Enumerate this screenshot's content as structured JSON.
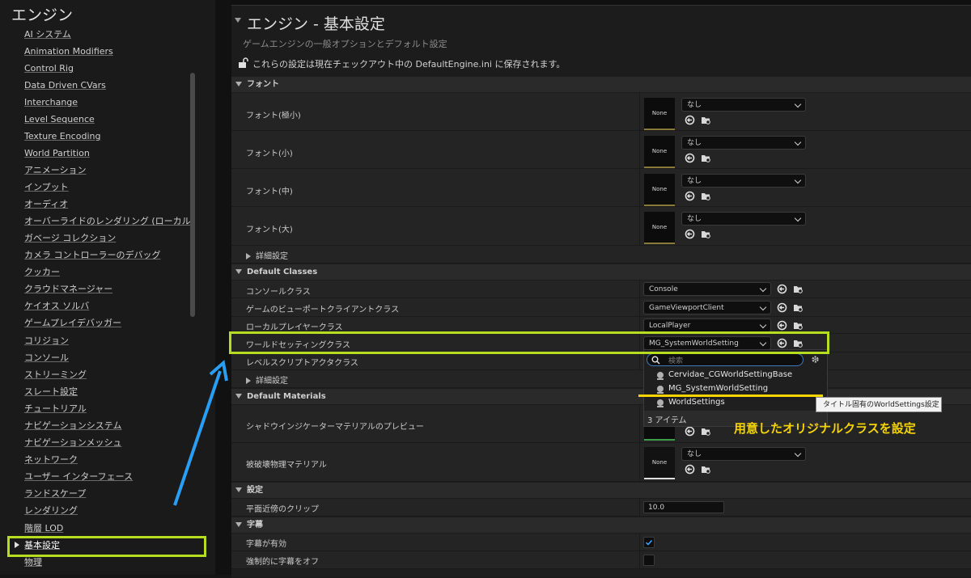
{
  "sidebar": {
    "title": "エンジン",
    "items": [
      {
        "label": "AI システム"
      },
      {
        "label": "Animation Modifiers"
      },
      {
        "label": "Control Rig"
      },
      {
        "label": "Data Driven CVars"
      },
      {
        "label": "Interchange"
      },
      {
        "label": "Level Sequence"
      },
      {
        "label": "Texture Encoding"
      },
      {
        "label": "World Partition"
      },
      {
        "label": "アニメーション"
      },
      {
        "label": "インプット"
      },
      {
        "label": "オーディオ"
      },
      {
        "label": "オーバーライドのレンダリング (ローカル)"
      },
      {
        "label": "ガベージ コレクション"
      },
      {
        "label": "カメラ コントローラーのデバッグ"
      },
      {
        "label": "クッカー"
      },
      {
        "label": "クラウドマネージャー"
      },
      {
        "label": "ケイオス ソルバ"
      },
      {
        "label": "ゲームプレイデバッガー"
      },
      {
        "label": "コリジョン"
      },
      {
        "label": "コンソール"
      },
      {
        "label": "ストリーミング"
      },
      {
        "label": "スレート設定"
      },
      {
        "label": "チュートリアル"
      },
      {
        "label": "ナビゲーションシステム"
      },
      {
        "label": "ナビゲーションメッシュ"
      },
      {
        "label": "ネットワーク"
      },
      {
        "label": "ユーザー インターフェース"
      },
      {
        "label": "ランドスケープ"
      },
      {
        "label": "レンダリング"
      },
      {
        "label": "階層 LOD"
      },
      {
        "label": "基本設定",
        "selected": true
      },
      {
        "label": "物理"
      }
    ]
  },
  "main": {
    "title": "エンジン - 基本設定",
    "subtitle": "ゲームエンジンの一般オプションとデフォルト設定",
    "config_note": "これらの設定は現在チェックアウト中の DefaultEngine.ini に保存されます。",
    "sections": {
      "fonts": {
        "header": "フォント",
        "rows": [
          {
            "label": "フォント(極小)",
            "thumb": "None",
            "value": "なし"
          },
          {
            "label": "フォント(小)",
            "thumb": "None",
            "value": "なし"
          },
          {
            "label": "フォント(中)",
            "thumb": "None",
            "value": "なし"
          },
          {
            "label": "フォント(大)",
            "thumb": "None",
            "value": "なし"
          }
        ],
        "advanced": "詳細設定"
      },
      "default_classes": {
        "header": "Default Classes",
        "rows": [
          {
            "label": "コンソールクラス",
            "value": "Console"
          },
          {
            "label": "ゲームのビューポートクライアントクラス",
            "value": "GameViewportClient"
          },
          {
            "label": "ローカルプレイヤークラス",
            "value": "LocalPlayer"
          },
          {
            "label": "ワールドセッティングクラス",
            "value": "MG_SystemWorldSetting"
          },
          {
            "label": "レベルスクリプトアクタクラス",
            "value": ""
          }
        ],
        "advanced": "詳細設定"
      },
      "default_materials": {
        "header": "Default Materials",
        "rows": [
          {
            "label": "シャドウインジケーターマテリアルのプレビュー"
          },
          {
            "label": "被破壊物理マテリアル",
            "thumb": "None",
            "value": "なし"
          }
        ]
      },
      "settings": {
        "header": "設定",
        "rows": [
          {
            "label": "平面近傍のクリップ",
            "value": "10.0"
          }
        ]
      },
      "subtitles": {
        "header": "字幕",
        "rows": [
          {
            "label": "字幕が有効",
            "checked": true
          },
          {
            "label": "強制的に字幕をオフ",
            "checked": false
          }
        ]
      }
    }
  },
  "class_picker": {
    "search_placeholder": "検索",
    "items": [
      {
        "label": "Cervidae_CGWorldSettingBase"
      },
      {
        "label": "MG_SystemWorldSetting"
      },
      {
        "label": "WorldSettings"
      }
    ],
    "count": "3 アイテム",
    "tooltip": "タイトル固有のWorldSettings設定"
  },
  "annotation": {
    "text": "用意したオリジナルクラスを設定",
    "highlight_color": "#b6dd1f",
    "arrow_color": "#2a9df4",
    "underline_color": "#f5d400"
  }
}
